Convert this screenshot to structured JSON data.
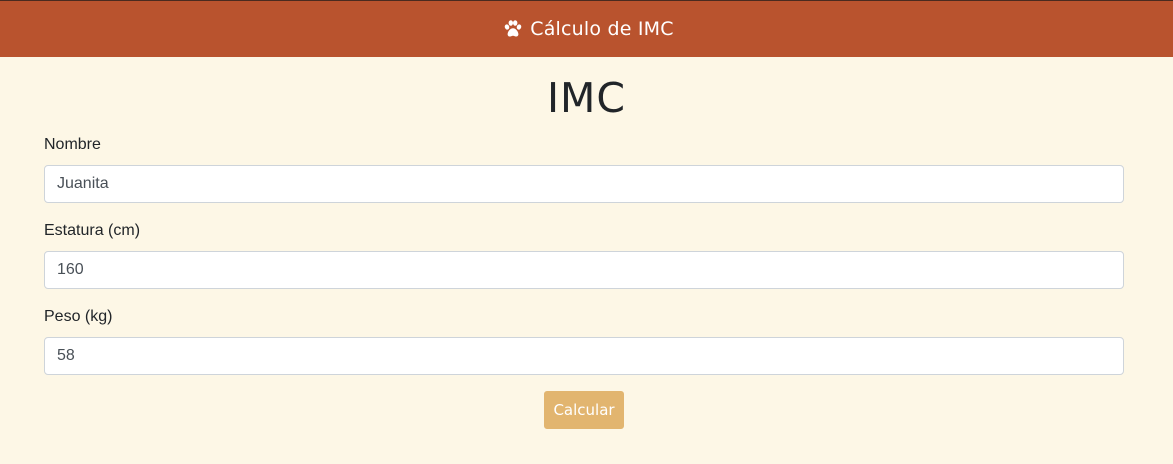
{
  "navbar": {
    "brand_icon": "paw-icon",
    "brand_text": "Cálculo de IMC",
    "background_color": "#b9532e"
  },
  "page": {
    "title": "IMC",
    "background_color": "#fdf7e6"
  },
  "form": {
    "name": {
      "label": "Nombre",
      "value": "Juanita"
    },
    "height": {
      "label": "Estatura (cm)",
      "value": "160"
    },
    "weight": {
      "label": "Peso (kg)",
      "value": "58"
    },
    "submit": {
      "label": "Calcular",
      "color": "#e2b56f"
    }
  }
}
